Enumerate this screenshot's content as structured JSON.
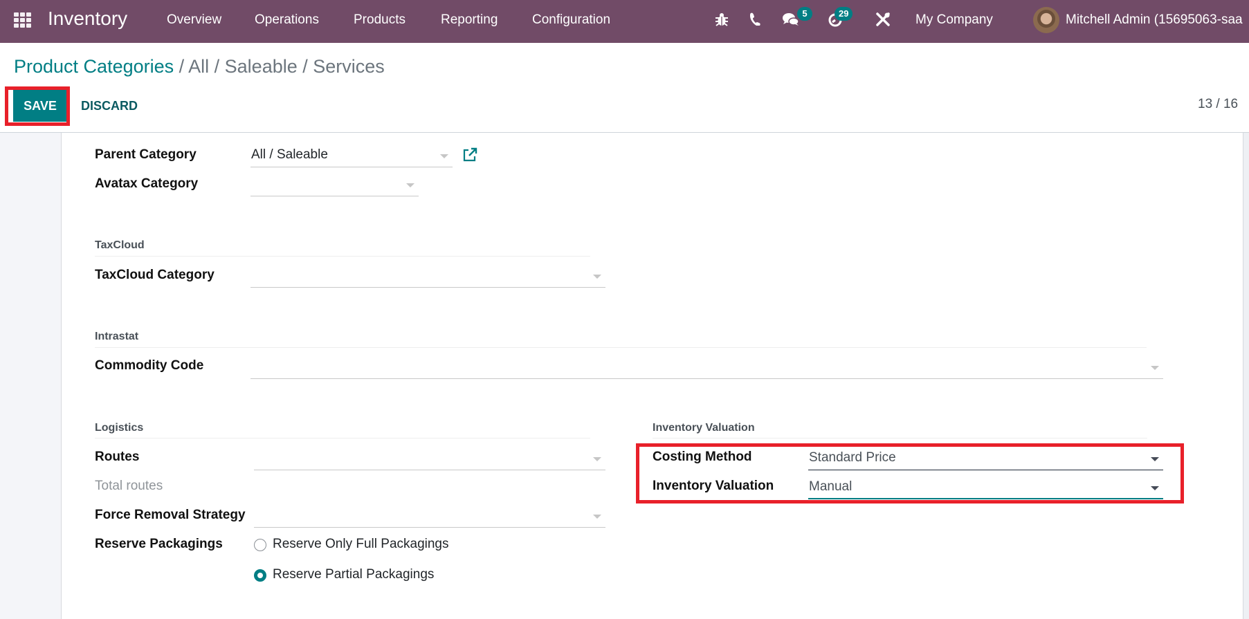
{
  "navbar": {
    "app_name": "Inventory",
    "menu": [
      "Overview",
      "Operations",
      "Products",
      "Reporting",
      "Configuration"
    ],
    "icons": [
      "bug-icon",
      "phone-icon",
      "chat-icon",
      "activity-clock-icon",
      "tools-icon"
    ],
    "messages_badge": "5",
    "activities_badge": "29",
    "company": "My Company",
    "user": "Mitchell Admin (15695063-saa"
  },
  "control_panel": {
    "breadcrumb_link": "Product Categories",
    "breadcrumb_rest": " / All / Saleable / Services",
    "save_label": "SAVE",
    "discard_label": "DISCARD",
    "pager": "13 / 16"
  },
  "form": {
    "parent_category": {
      "label": "Parent Category",
      "value": "All / Saleable"
    },
    "avatax_category": {
      "label": "Avatax Category",
      "value": ""
    },
    "taxcloud": {
      "title": "TaxCloud",
      "category_label": "TaxCloud Category",
      "category_value": ""
    },
    "intrastat": {
      "title": "Intrastat",
      "commodity_label": "Commodity Code",
      "commodity_value": ""
    },
    "logistics": {
      "title": "Logistics",
      "routes_label": "Routes",
      "routes_value": "",
      "total_routes_label": "Total routes",
      "force_removal_label": "Force Removal Strategy",
      "force_removal_value": "",
      "reserve_packagings_label": "Reserve Packagings",
      "reserve_options": [
        {
          "label": "Reserve Only Full Packagings",
          "checked": false
        },
        {
          "label": "Reserve Partial Packagings",
          "checked": true
        }
      ]
    },
    "inventory_valuation": {
      "title": "Inventory Valuation",
      "costing_method_label": "Costing Method",
      "costing_method_value": "Standard Price",
      "valuation_label": "Inventory Valuation",
      "valuation_value": "Manual"
    }
  },
  "colors": {
    "navbar": "#714B67",
    "primary": "#017e84",
    "highlight": "#e8202a"
  }
}
